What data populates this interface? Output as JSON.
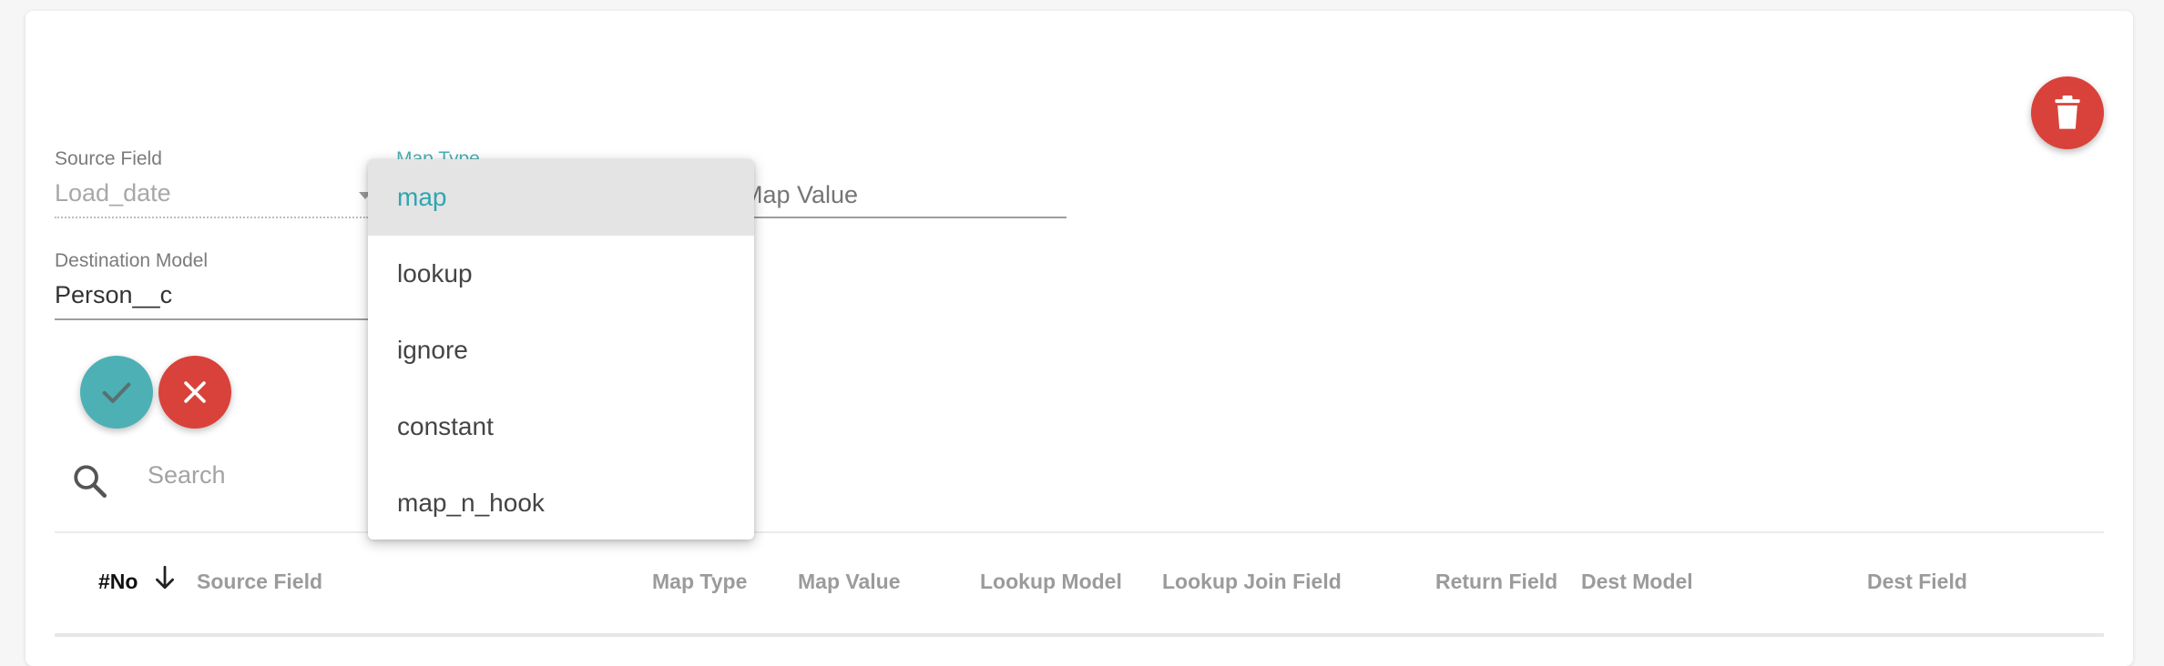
{
  "form": {
    "source_field": {
      "label": "Source Field",
      "value": "Load_date"
    },
    "map_type": {
      "label": "Map Type"
    },
    "map_value": {
      "placeholder": "Map Value"
    },
    "destination_model": {
      "label": "Destination Model",
      "value": "Person__c"
    }
  },
  "search": {
    "placeholder": "Search"
  },
  "dropdown": {
    "options": [
      "map",
      "lookup",
      "ignore",
      "constant",
      "map_n_hook"
    ],
    "selected": "map"
  },
  "table": {
    "headers": {
      "no": "#No",
      "source_field": "Source Field",
      "map_type": "Map Type",
      "map_value": "Map Value",
      "lookup_model": "Lookup Model",
      "lookup_join_field": "Lookup Join Field",
      "return_field": "Return Field",
      "dest_model": "Dest Model",
      "dest_field": "Dest Field"
    },
    "sort_column": "#No",
    "sort_direction": "descending"
  },
  "icons": {
    "delete": "trash-icon",
    "confirm": "check-icon",
    "cancel": "close-icon",
    "search": "search-icon",
    "sort": "arrow-down-icon",
    "select": "caret-down-icon"
  },
  "colors": {
    "accent": "#4db0b5",
    "danger": "#d9423a",
    "selected_text": "#2fa6b0"
  }
}
